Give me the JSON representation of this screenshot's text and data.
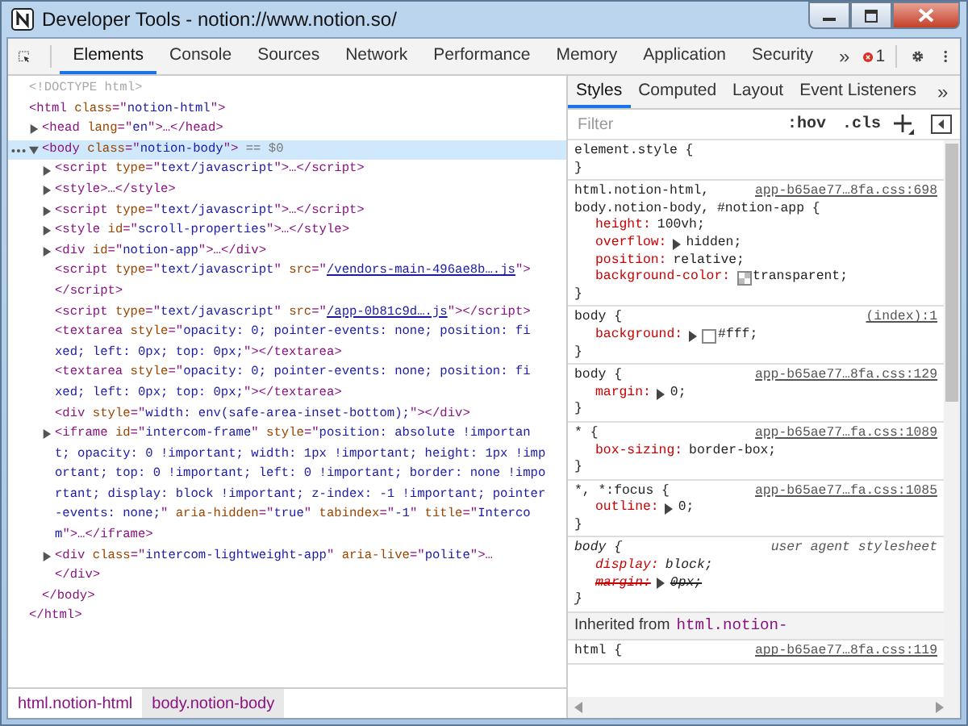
{
  "window": {
    "title": "Developer Tools - notion://www.notion.so/"
  },
  "tabs": [
    {
      "label": "Elements",
      "selected": true
    },
    {
      "label": "Console",
      "selected": false
    },
    {
      "label": "Sources",
      "selected": false
    },
    {
      "label": "Network",
      "selected": false
    },
    {
      "label": "Performance",
      "selected": false
    },
    {
      "label": "Memory",
      "selected": false
    },
    {
      "label": "Application",
      "selected": false
    },
    {
      "label": "Security",
      "selected": false
    }
  ],
  "tabs_overflow": "»",
  "error_count": "1",
  "dom": [
    {
      "lines": [
        [
          {
            "kind": "gray",
            "text": "<!DOCTYPE html>"
          }
        ]
      ]
    },
    {
      "lines": [
        [
          {
            "kind": "tag",
            "text": "<html "
          },
          {
            "kind": "attr",
            "text": "class"
          },
          {
            "kind": "tag",
            "text": "=\""
          },
          {
            "kind": "val",
            "text": "notion-html"
          },
          {
            "kind": "tag",
            "text": "\">"
          }
        ]
      ],
      "children": [
        {
          "expanded": false,
          "lines": [
            [
              {
                "kind": "tag",
                "text": "<head "
              },
              {
                "kind": "attr",
                "text": "lang"
              },
              {
                "kind": "tag",
                "text": "=\""
              },
              {
                "kind": "val",
                "text": "en"
              },
              {
                "kind": "tag",
                "text": "\">…</head>"
              }
            ]
          ]
        },
        {
          "expanded": true,
          "selected": true,
          "lines": [
            [
              {
                "kind": "tag",
                "text": "<body "
              },
              {
                "kind": "attr",
                "text": "class"
              },
              {
                "kind": "tag",
                "text": "=\""
              },
              {
                "kind": "val",
                "text": "notion-body"
              },
              {
                "kind": "tag",
                "text": "\">"
              },
              {
                "kind": "ref",
                "text": " == $0"
              }
            ]
          ],
          "children": [
            {
              "expanded": false,
              "lines": [
                [
                  {
                    "kind": "tag",
                    "text": "<script "
                  },
                  {
                    "kind": "attr",
                    "text": "type"
                  },
                  {
                    "kind": "tag",
                    "text": "=\""
                  },
                  {
                    "kind": "val",
                    "text": "text/javascript"
                  },
                  {
                    "kind": "tag",
                    "text": "\">…</script>"
                  }
                ]
              ]
            },
            {
              "expanded": false,
              "lines": [
                [
                  {
                    "kind": "tag",
                    "text": "<style>…</style>"
                  }
                ]
              ]
            },
            {
              "expanded": false,
              "lines": [
                [
                  {
                    "kind": "tag",
                    "text": "<script "
                  },
                  {
                    "kind": "attr",
                    "text": "type"
                  },
                  {
                    "kind": "tag",
                    "text": "=\""
                  },
                  {
                    "kind": "val",
                    "text": "text/javascript"
                  },
                  {
                    "kind": "tag",
                    "text": "\">…</script>"
                  }
                ]
              ]
            },
            {
              "expanded": false,
              "lines": [
                [
                  {
                    "kind": "tag",
                    "text": "<style "
                  },
                  {
                    "kind": "attr",
                    "text": "id"
                  },
                  {
                    "kind": "tag",
                    "text": "=\""
                  },
                  {
                    "kind": "val",
                    "text": "scroll-properties"
                  },
                  {
                    "kind": "tag",
                    "text": "\">…</style>"
                  }
                ]
              ]
            },
            {
              "expanded": false,
              "lines": [
                [
                  {
                    "kind": "tag",
                    "text": "<div "
                  },
                  {
                    "kind": "attr",
                    "text": "id"
                  },
                  {
                    "kind": "tag",
                    "text": "=\""
                  },
                  {
                    "kind": "val",
                    "text": "notion-app"
                  },
                  {
                    "kind": "tag",
                    "text": "\">…</div>"
                  }
                ]
              ]
            },
            {
              "lines": [
                [
                  {
                    "kind": "tag",
                    "text": "<script "
                  },
                  {
                    "kind": "attr",
                    "text": "type"
                  },
                  {
                    "kind": "tag",
                    "text": "=\""
                  },
                  {
                    "kind": "val",
                    "text": "text/javascript"
                  },
                  {
                    "kind": "tag",
                    "text": "\" "
                  },
                  {
                    "kind": "attr",
                    "text": "src"
                  },
                  {
                    "kind": "tag",
                    "text": "=\""
                  },
                  {
                    "kind": "link",
                    "text": "/vendors-main-496ae8b….js"
                  },
                  {
                    "kind": "tag",
                    "text": "\">"
                  }
                ],
                [
                  {
                    "kind": "tag",
                    "text": "</script>"
                  }
                ]
              ]
            },
            {
              "lines": [
                [
                  {
                    "kind": "tag",
                    "text": "<script "
                  },
                  {
                    "kind": "attr",
                    "text": "type"
                  },
                  {
                    "kind": "tag",
                    "text": "=\""
                  },
                  {
                    "kind": "val",
                    "text": "text/javascript"
                  },
                  {
                    "kind": "tag",
                    "text": "\" "
                  },
                  {
                    "kind": "attr",
                    "text": "src"
                  },
                  {
                    "kind": "tag",
                    "text": "=\""
                  },
                  {
                    "kind": "link",
                    "text": "/app-0b81c9d….js"
                  },
                  {
                    "kind": "tag",
                    "text": "\"></script>"
                  }
                ]
              ]
            },
            {
              "lines": [
                [
                  {
                    "kind": "tag",
                    "text": "<textarea "
                  },
                  {
                    "kind": "attr",
                    "text": "style"
                  },
                  {
                    "kind": "tag",
                    "text": "=\""
                  },
                  {
                    "kind": "val",
                    "text": "opacity: 0; pointer-events: none; position: fi"
                  }
                ],
                [
                  {
                    "kind": "val",
                    "text": "xed; left: 0px; top: 0px;"
                  },
                  {
                    "kind": "tag",
                    "text": "\"></textarea>"
                  }
                ]
              ]
            },
            {
              "lines": [
                [
                  {
                    "kind": "tag",
                    "text": "<textarea "
                  },
                  {
                    "kind": "attr",
                    "text": "style"
                  },
                  {
                    "kind": "tag",
                    "text": "=\""
                  },
                  {
                    "kind": "val",
                    "text": "opacity: 0; pointer-events: none; position: fi"
                  }
                ],
                [
                  {
                    "kind": "val",
                    "text": "xed; left: 0px; top: 0px;"
                  },
                  {
                    "kind": "tag",
                    "text": "\"></textarea>"
                  }
                ]
              ]
            },
            {
              "lines": [
                [
                  {
                    "kind": "tag",
                    "text": "<div "
                  },
                  {
                    "kind": "attr",
                    "text": "style"
                  },
                  {
                    "kind": "tag",
                    "text": "=\""
                  },
                  {
                    "kind": "val",
                    "text": "width: env(safe-area-inset-bottom);"
                  },
                  {
                    "kind": "tag",
                    "text": "\"></div>"
                  }
                ]
              ]
            },
            {
              "expanded": false,
              "lines": [
                [
                  {
                    "kind": "tag",
                    "text": "<iframe "
                  },
                  {
                    "kind": "attr",
                    "text": "id"
                  },
                  {
                    "kind": "tag",
                    "text": "=\""
                  },
                  {
                    "kind": "val",
                    "text": "intercom-frame"
                  },
                  {
                    "kind": "tag",
                    "text": "\" "
                  },
                  {
                    "kind": "attr",
                    "text": "style"
                  },
                  {
                    "kind": "tag",
                    "text": "=\""
                  },
                  {
                    "kind": "val",
                    "text": "position: absolute !importan"
                  }
                ],
                [
                  {
                    "kind": "val",
                    "text": "t; opacity: 0 !important; width: 1px !important; height: 1px !imp"
                  }
                ],
                [
                  {
                    "kind": "val",
                    "text": "ortant; top: 0 !important; left: 0 !important; border: none !impo"
                  }
                ],
                [
                  {
                    "kind": "val",
                    "text": "rtant; display: block !important; z-index: -1 !important; pointer"
                  }
                ],
                [
                  {
                    "kind": "val",
                    "text": "-events: none;"
                  },
                  {
                    "kind": "tag",
                    "text": "\" "
                  },
                  {
                    "kind": "attr",
                    "text": "aria-hidden"
                  },
                  {
                    "kind": "tag",
                    "text": "=\""
                  },
                  {
                    "kind": "val",
                    "text": "true"
                  },
                  {
                    "kind": "tag",
                    "text": "\" "
                  },
                  {
                    "kind": "attr",
                    "text": "tabindex"
                  },
                  {
                    "kind": "tag",
                    "text": "=\""
                  },
                  {
                    "kind": "val",
                    "text": "-1"
                  },
                  {
                    "kind": "tag",
                    "text": "\" "
                  },
                  {
                    "kind": "attr",
                    "text": "title"
                  },
                  {
                    "kind": "tag",
                    "text": "=\""
                  },
                  {
                    "kind": "val",
                    "text": "Interco"
                  }
                ],
                [
                  {
                    "kind": "val",
                    "text": "m"
                  },
                  {
                    "kind": "tag",
                    "text": "\">…</iframe>"
                  }
                ]
              ]
            },
            {
              "expanded": false,
              "lines": [
                [
                  {
                    "kind": "tag",
                    "text": "<div "
                  },
                  {
                    "kind": "attr",
                    "text": "class"
                  },
                  {
                    "kind": "tag",
                    "text": "=\""
                  },
                  {
                    "kind": "val",
                    "text": "intercom-lightweight-app"
                  },
                  {
                    "kind": "tag",
                    "text": "\" "
                  },
                  {
                    "kind": "attr",
                    "text": "aria-live"
                  },
                  {
                    "kind": "tag",
                    "text": "=\""
                  },
                  {
                    "kind": "val",
                    "text": "polite"
                  },
                  {
                    "kind": "tag",
                    "text": "\">…"
                  }
                ],
                [
                  {
                    "kind": "tag",
                    "text": "</div>"
                  }
                ]
              ]
            }
          ],
          "closing": [
            {
              "kind": "tag",
              "text": "</body>"
            }
          ]
        }
      ],
      "closing": [
        {
          "kind": "tag",
          "text": "</html>"
        }
      ]
    }
  ],
  "breadcrumbs": [
    {
      "label": "html.notion-html",
      "selected": false
    },
    {
      "label": "body.notion-body",
      "selected": true
    }
  ],
  "side_tabs": [
    {
      "label": "Styles",
      "selected": true
    },
    {
      "label": "Computed",
      "selected": false
    },
    {
      "label": "Layout",
      "selected": false
    },
    {
      "label": "Event Listeners",
      "selected": false
    }
  ],
  "side_tabs_overflow": "»",
  "filter": {
    "placeholder": "Filter"
  },
  "filter_buttons": [
    ":hov",
    ".cls"
  ],
  "rules": [
    {
      "kind": "author",
      "selector": [
        "element.style {"
      ],
      "close": "}"
    },
    {
      "kind": "author",
      "selector": [
        "html.notion-html,",
        "body.notion-body, #notion-app {"
      ],
      "source": "app-b65ae77…8fa.css:698",
      "declarations": [
        {
          "prop": "height:",
          "value": "100vh;"
        },
        {
          "prop": "overflow:",
          "value": "hidden;",
          "expandable": true
        },
        {
          "prop": "position:",
          "value": "relative;"
        },
        {
          "prop": "background-color:",
          "value": "transparent;",
          "swatch": {
            "kind": "checker"
          }
        }
      ],
      "close": "}"
    },
    {
      "kind": "author",
      "selector": [
        "body {"
      ],
      "source": "(index):1",
      "declarations": [
        {
          "prop": "background:",
          "value": "#fff;",
          "expandable": true,
          "swatch": {
            "kind": "solid",
            "color": "#ffffff"
          }
        }
      ],
      "close": "}"
    },
    {
      "kind": "author",
      "selector": [
        "body {"
      ],
      "source": "app-b65ae77…8fa.css:129",
      "declarations": [
        {
          "prop": "margin:",
          "value": "0;",
          "expandable": true
        }
      ],
      "close": "}"
    },
    {
      "kind": "author",
      "selector": [
        "* {"
      ],
      "source": "app-b65ae77…fa.css:1089",
      "declarations": [
        {
          "prop": "box-sizing:",
          "value": "border-box;"
        }
      ],
      "close": "}"
    },
    {
      "kind": "author",
      "selector": [
        "*, *:focus {"
      ],
      "source": "app-b65ae77…fa.css:1085",
      "declarations": [
        {
          "prop": "outline:",
          "value": "0;",
          "expandable": true
        }
      ],
      "close": "}"
    },
    {
      "kind": "user-agent",
      "selector": [
        "body {"
      ],
      "source": "user agent stylesheet",
      "declarations": [
        {
          "prop": "display:",
          "value": "block;"
        },
        {
          "prop": "margin:",
          "value": "0px;",
          "expandable": true,
          "struck": true
        }
      ],
      "close": "}"
    }
  ],
  "inherited": {
    "label": "Inherited from",
    "element": "html.notion-"
  },
  "inherited_rules": [
    {
      "kind": "author",
      "selector": [
        "html {"
      ],
      "source": "app-b65ae77…8fa.css:119"
    }
  ]
}
